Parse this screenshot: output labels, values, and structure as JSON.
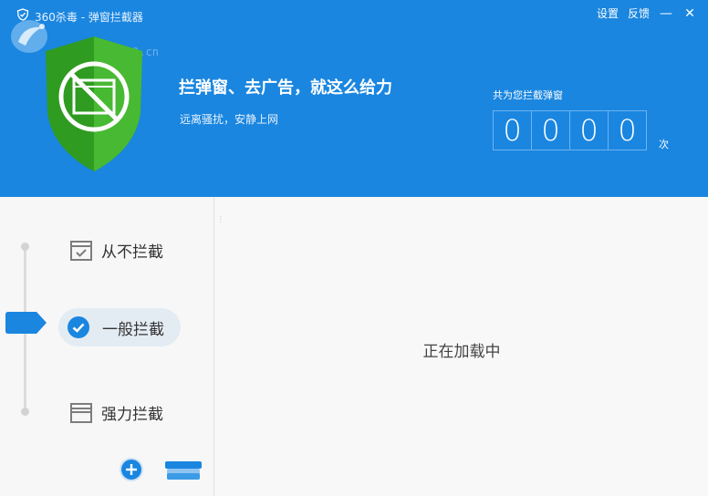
{
  "window": {
    "title": "360杀毒 - 弹窗拦截器",
    "watermark": "www.pc0359.cn",
    "links": {
      "settings": "设置",
      "feedback": "反馈"
    },
    "minimize": "—",
    "close": "✕"
  },
  "hero": {
    "slogan": "拦弹窗、去广告，就这么给力",
    "subslogan": "远离骚扰，安静上网",
    "counter_label": "共为您拦截弹窗",
    "counter_digits": [
      "0",
      "0",
      "0",
      "0"
    ],
    "counter_unit": "次"
  },
  "modes": {
    "never": "从不拦截",
    "normal": "一般拦截",
    "strong": "强力拦截",
    "selected": "normal"
  },
  "main": {
    "status": "正在加载中"
  },
  "colors": {
    "header_bg": "#1a86e0",
    "shield_green": "#3fae2a",
    "accent_blue": "#1a86e0"
  },
  "icons": {
    "title": "shield-icon",
    "shield": "blocked-window-shield-icon",
    "never": "checked-window-icon",
    "normal": "checkmark-circle-icon",
    "strong": "window-icon",
    "add": "plus-circle-icon",
    "tray": "tray-icon"
  }
}
